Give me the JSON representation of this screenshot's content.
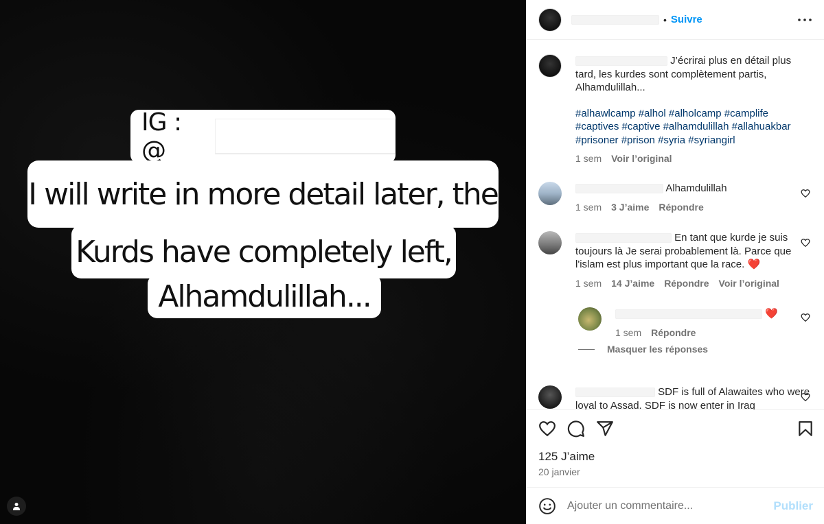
{
  "media": {
    "ig_prefix": "IG : @",
    "overlay_lines": [
      "I will write in more detail later, the",
      "Kurds have completely left,",
      "Alhamdulillah..."
    ],
    "user_badge_icon": "person-icon"
  },
  "header": {
    "separator": "•",
    "follow_label": "Suivre",
    "more_icon": "more-options-icon"
  },
  "caption": {
    "text": "J’écrirai plus en détail plus tard, les kurdes sont complètement partis, Alhamdulillah...",
    "hashtags": "#alhawlcamp #alhol #alholcamp #camplife #captives #captive #alhamdulillah #allahuakbar #prisoner #prison #syria #syriangirl",
    "time": "1 sem",
    "see_original": "Voir l’original"
  },
  "comments": [
    {
      "text": "Alhamdulillah",
      "time": "1 sem",
      "likes": "3 J’aime",
      "reply": "Répondre"
    },
    {
      "text": "En tant que kurde je suis toujours là Je serai probablement là. Parce que l'islam est plus important que la race. ❤️",
      "time": "1 sem",
      "likes": "14 J’aime",
      "reply": "Répondre",
      "see_original": "Voir l’original"
    },
    {
      "text": "❤️",
      "time": "1 sem",
      "reply": "Répondre",
      "hide_replies": "Masquer les réponses"
    },
    {
      "text": "SDF is full of Alawaites who were loyal to Assad. SDF is now enter in Iraq"
    }
  ],
  "actions": {
    "like_icon": "heart-icon",
    "comment_icon": "comment-icon",
    "share_icon": "share-icon",
    "save_icon": "bookmark-icon",
    "likes_count": "125 J’aime",
    "date": "20 janvier"
  },
  "composer": {
    "emoji_icon": "emoji-icon",
    "placeholder": "Ajouter un commentaire...",
    "publish_label": "Publier"
  }
}
